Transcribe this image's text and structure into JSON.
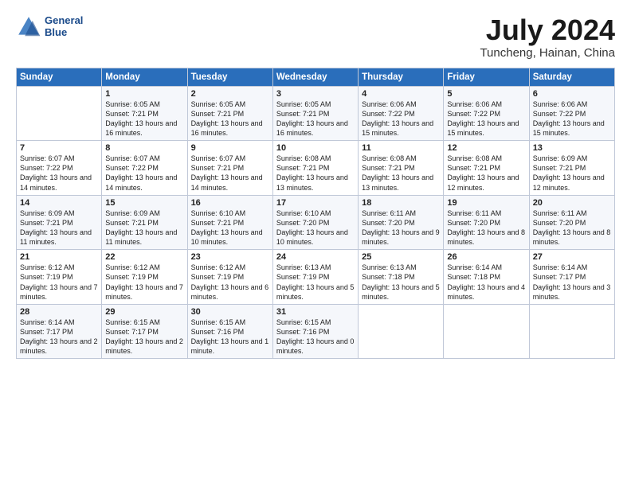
{
  "logo": {
    "line1": "General",
    "line2": "Blue"
  },
  "title": "July 2024",
  "subtitle": "Tuncheng, Hainan, China",
  "weekdays": [
    "Sunday",
    "Monday",
    "Tuesday",
    "Wednesday",
    "Thursday",
    "Friday",
    "Saturday"
  ],
  "weeks": [
    [
      {
        "day": "",
        "sunrise": "",
        "sunset": "",
        "daylight": ""
      },
      {
        "day": "1",
        "sunrise": "Sunrise: 6:05 AM",
        "sunset": "Sunset: 7:21 PM",
        "daylight": "Daylight: 13 hours and 16 minutes."
      },
      {
        "day": "2",
        "sunrise": "Sunrise: 6:05 AM",
        "sunset": "Sunset: 7:21 PM",
        "daylight": "Daylight: 13 hours and 16 minutes."
      },
      {
        "day": "3",
        "sunrise": "Sunrise: 6:05 AM",
        "sunset": "Sunset: 7:21 PM",
        "daylight": "Daylight: 13 hours and 16 minutes."
      },
      {
        "day": "4",
        "sunrise": "Sunrise: 6:06 AM",
        "sunset": "Sunset: 7:22 PM",
        "daylight": "Daylight: 13 hours and 15 minutes."
      },
      {
        "day": "5",
        "sunrise": "Sunrise: 6:06 AM",
        "sunset": "Sunset: 7:22 PM",
        "daylight": "Daylight: 13 hours and 15 minutes."
      },
      {
        "day": "6",
        "sunrise": "Sunrise: 6:06 AM",
        "sunset": "Sunset: 7:22 PM",
        "daylight": "Daylight: 13 hours and 15 minutes."
      }
    ],
    [
      {
        "day": "7",
        "sunrise": "Sunrise: 6:07 AM",
        "sunset": "Sunset: 7:22 PM",
        "daylight": "Daylight: 13 hours and 14 minutes."
      },
      {
        "day": "8",
        "sunrise": "Sunrise: 6:07 AM",
        "sunset": "Sunset: 7:22 PM",
        "daylight": "Daylight: 13 hours and 14 minutes."
      },
      {
        "day": "9",
        "sunrise": "Sunrise: 6:07 AM",
        "sunset": "Sunset: 7:21 PM",
        "daylight": "Daylight: 13 hours and 14 minutes."
      },
      {
        "day": "10",
        "sunrise": "Sunrise: 6:08 AM",
        "sunset": "Sunset: 7:21 PM",
        "daylight": "Daylight: 13 hours and 13 minutes."
      },
      {
        "day": "11",
        "sunrise": "Sunrise: 6:08 AM",
        "sunset": "Sunset: 7:21 PM",
        "daylight": "Daylight: 13 hours and 13 minutes."
      },
      {
        "day": "12",
        "sunrise": "Sunrise: 6:08 AM",
        "sunset": "Sunset: 7:21 PM",
        "daylight": "Daylight: 13 hours and 12 minutes."
      },
      {
        "day": "13",
        "sunrise": "Sunrise: 6:09 AM",
        "sunset": "Sunset: 7:21 PM",
        "daylight": "Daylight: 13 hours and 12 minutes."
      }
    ],
    [
      {
        "day": "14",
        "sunrise": "Sunrise: 6:09 AM",
        "sunset": "Sunset: 7:21 PM",
        "daylight": "Daylight: 13 hours and 11 minutes."
      },
      {
        "day": "15",
        "sunrise": "Sunrise: 6:09 AM",
        "sunset": "Sunset: 7:21 PM",
        "daylight": "Daylight: 13 hours and 11 minutes."
      },
      {
        "day": "16",
        "sunrise": "Sunrise: 6:10 AM",
        "sunset": "Sunset: 7:21 PM",
        "daylight": "Daylight: 13 hours and 10 minutes."
      },
      {
        "day": "17",
        "sunrise": "Sunrise: 6:10 AM",
        "sunset": "Sunset: 7:20 PM",
        "daylight": "Daylight: 13 hours and 10 minutes."
      },
      {
        "day": "18",
        "sunrise": "Sunrise: 6:11 AM",
        "sunset": "Sunset: 7:20 PM",
        "daylight": "Daylight: 13 hours and 9 minutes."
      },
      {
        "day": "19",
        "sunrise": "Sunrise: 6:11 AM",
        "sunset": "Sunset: 7:20 PM",
        "daylight": "Daylight: 13 hours and 8 minutes."
      },
      {
        "day": "20",
        "sunrise": "Sunrise: 6:11 AM",
        "sunset": "Sunset: 7:20 PM",
        "daylight": "Daylight: 13 hours and 8 minutes."
      }
    ],
    [
      {
        "day": "21",
        "sunrise": "Sunrise: 6:12 AM",
        "sunset": "Sunset: 7:19 PM",
        "daylight": "Daylight: 13 hours and 7 minutes."
      },
      {
        "day": "22",
        "sunrise": "Sunrise: 6:12 AM",
        "sunset": "Sunset: 7:19 PM",
        "daylight": "Daylight: 13 hours and 7 minutes."
      },
      {
        "day": "23",
        "sunrise": "Sunrise: 6:12 AM",
        "sunset": "Sunset: 7:19 PM",
        "daylight": "Daylight: 13 hours and 6 minutes."
      },
      {
        "day": "24",
        "sunrise": "Sunrise: 6:13 AM",
        "sunset": "Sunset: 7:19 PM",
        "daylight": "Daylight: 13 hours and 5 minutes."
      },
      {
        "day": "25",
        "sunrise": "Sunrise: 6:13 AM",
        "sunset": "Sunset: 7:18 PM",
        "daylight": "Daylight: 13 hours and 5 minutes."
      },
      {
        "day": "26",
        "sunrise": "Sunrise: 6:14 AM",
        "sunset": "Sunset: 7:18 PM",
        "daylight": "Daylight: 13 hours and 4 minutes."
      },
      {
        "day": "27",
        "sunrise": "Sunrise: 6:14 AM",
        "sunset": "Sunset: 7:17 PM",
        "daylight": "Daylight: 13 hours and 3 minutes."
      }
    ],
    [
      {
        "day": "28",
        "sunrise": "Sunrise: 6:14 AM",
        "sunset": "Sunset: 7:17 PM",
        "daylight": "Daylight: 13 hours and 2 minutes."
      },
      {
        "day": "29",
        "sunrise": "Sunrise: 6:15 AM",
        "sunset": "Sunset: 7:17 PM",
        "daylight": "Daylight: 13 hours and 2 minutes."
      },
      {
        "day": "30",
        "sunrise": "Sunrise: 6:15 AM",
        "sunset": "Sunset: 7:16 PM",
        "daylight": "Daylight: 13 hours and 1 minute."
      },
      {
        "day": "31",
        "sunrise": "Sunrise: 6:15 AM",
        "sunset": "Sunset: 7:16 PM",
        "daylight": "Daylight: 13 hours and 0 minutes."
      },
      {
        "day": "",
        "sunrise": "",
        "sunset": "",
        "daylight": ""
      },
      {
        "day": "",
        "sunrise": "",
        "sunset": "",
        "daylight": ""
      },
      {
        "day": "",
        "sunrise": "",
        "sunset": "",
        "daylight": ""
      }
    ]
  ]
}
